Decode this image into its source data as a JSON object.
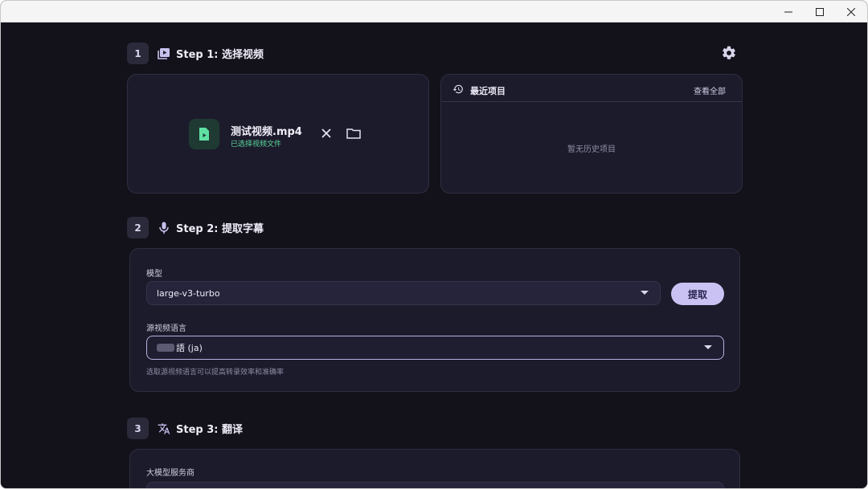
{
  "window": {
    "controls": {
      "minimize": "minimize",
      "maximize": "maximize",
      "close": "close"
    }
  },
  "step1": {
    "number": "1",
    "title": "Step 1: 选择视频",
    "file": {
      "name": "测试视频.mp4",
      "status": "已选择视频文件"
    },
    "recent": {
      "title": "最近项目",
      "view_all": "查看全部",
      "empty": "暂无历史项目"
    }
  },
  "step2": {
    "number": "2",
    "title": "Step 2: 提取字幕",
    "model_label": "模型",
    "model_value": "large-v3-turbo",
    "extract_button": "提取",
    "lang_label": "源视频语言",
    "lang_value": "語 (ja)",
    "lang_helper": "选取源视频语言可以提高转录效率和准确率"
  },
  "step3": {
    "number": "3",
    "title": "Step 3: 翻译",
    "provider_label": "大模型服务商"
  },
  "colors": {
    "accent": "#c9c2f2",
    "success": "#58d69a",
    "background": "#13121b",
    "card": "#1c1b2b"
  }
}
